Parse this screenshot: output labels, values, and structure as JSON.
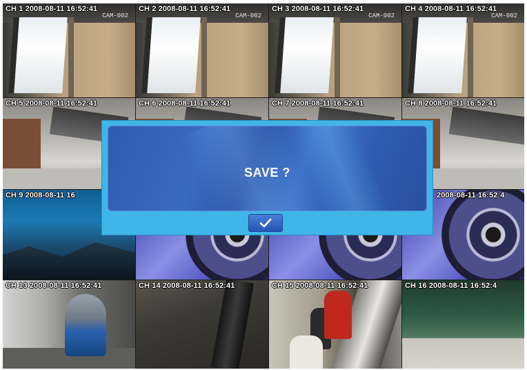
{
  "channels": [
    {
      "label": "CH 1 2008-08-11 16:52:41",
      "sub": "CAM-002"
    },
    {
      "label": "CH 2 2008-08-11 16:52:41",
      "sub": "CAM-002"
    },
    {
      "label": "CH 3 2008-08-11 16:52:41",
      "sub": "CAM-002"
    },
    {
      "label": "CH 4 2008-08-11 16:52:41",
      "sub": "CAM-002"
    },
    {
      "label": "CH 5 2008-08-11 16:52:41"
    },
    {
      "label": "CH 6 2008-08-11 16:52:41"
    },
    {
      "label": "CH 7 2008-08-11 16:52:41"
    },
    {
      "label": "CH 8 2008-08-11 16:52:41"
    },
    {
      "label": "CH 9 2008-08-11 16"
    },
    {
      "label": ""
    },
    {
      "label": ""
    },
    {
      "label": "2008-08-11 16:52:4"
    },
    {
      "label": "CH 13 2008-08-11 16:52:41"
    },
    {
      "label": "CH 14 2008-08-11 16:52:41"
    },
    {
      "label": "CH 15 2008-08-11 16:52:41"
    },
    {
      "label": "CH 16 2008-08-11 16:52:4"
    }
  ],
  "dialog": {
    "message": "SAVE ?",
    "confirm_icon": "checkmark-icon"
  },
  "colors": {
    "dialog_frame": "#3fb5e8",
    "dialog_panel": "#2f5cb0",
    "confirm_button": "#2554b4"
  }
}
